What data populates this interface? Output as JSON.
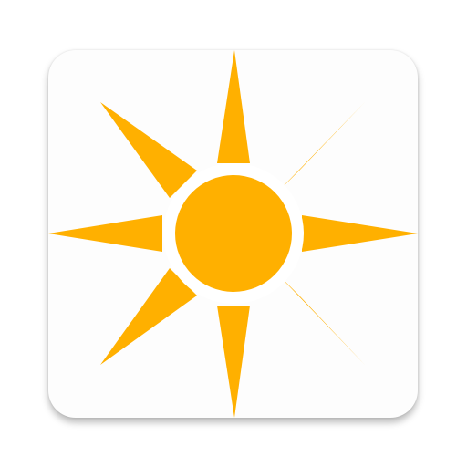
{
  "app_icon": {
    "icon_name": "sun-icon",
    "background_color": "#fdfdfd",
    "sun_color": "#ffb000"
  }
}
